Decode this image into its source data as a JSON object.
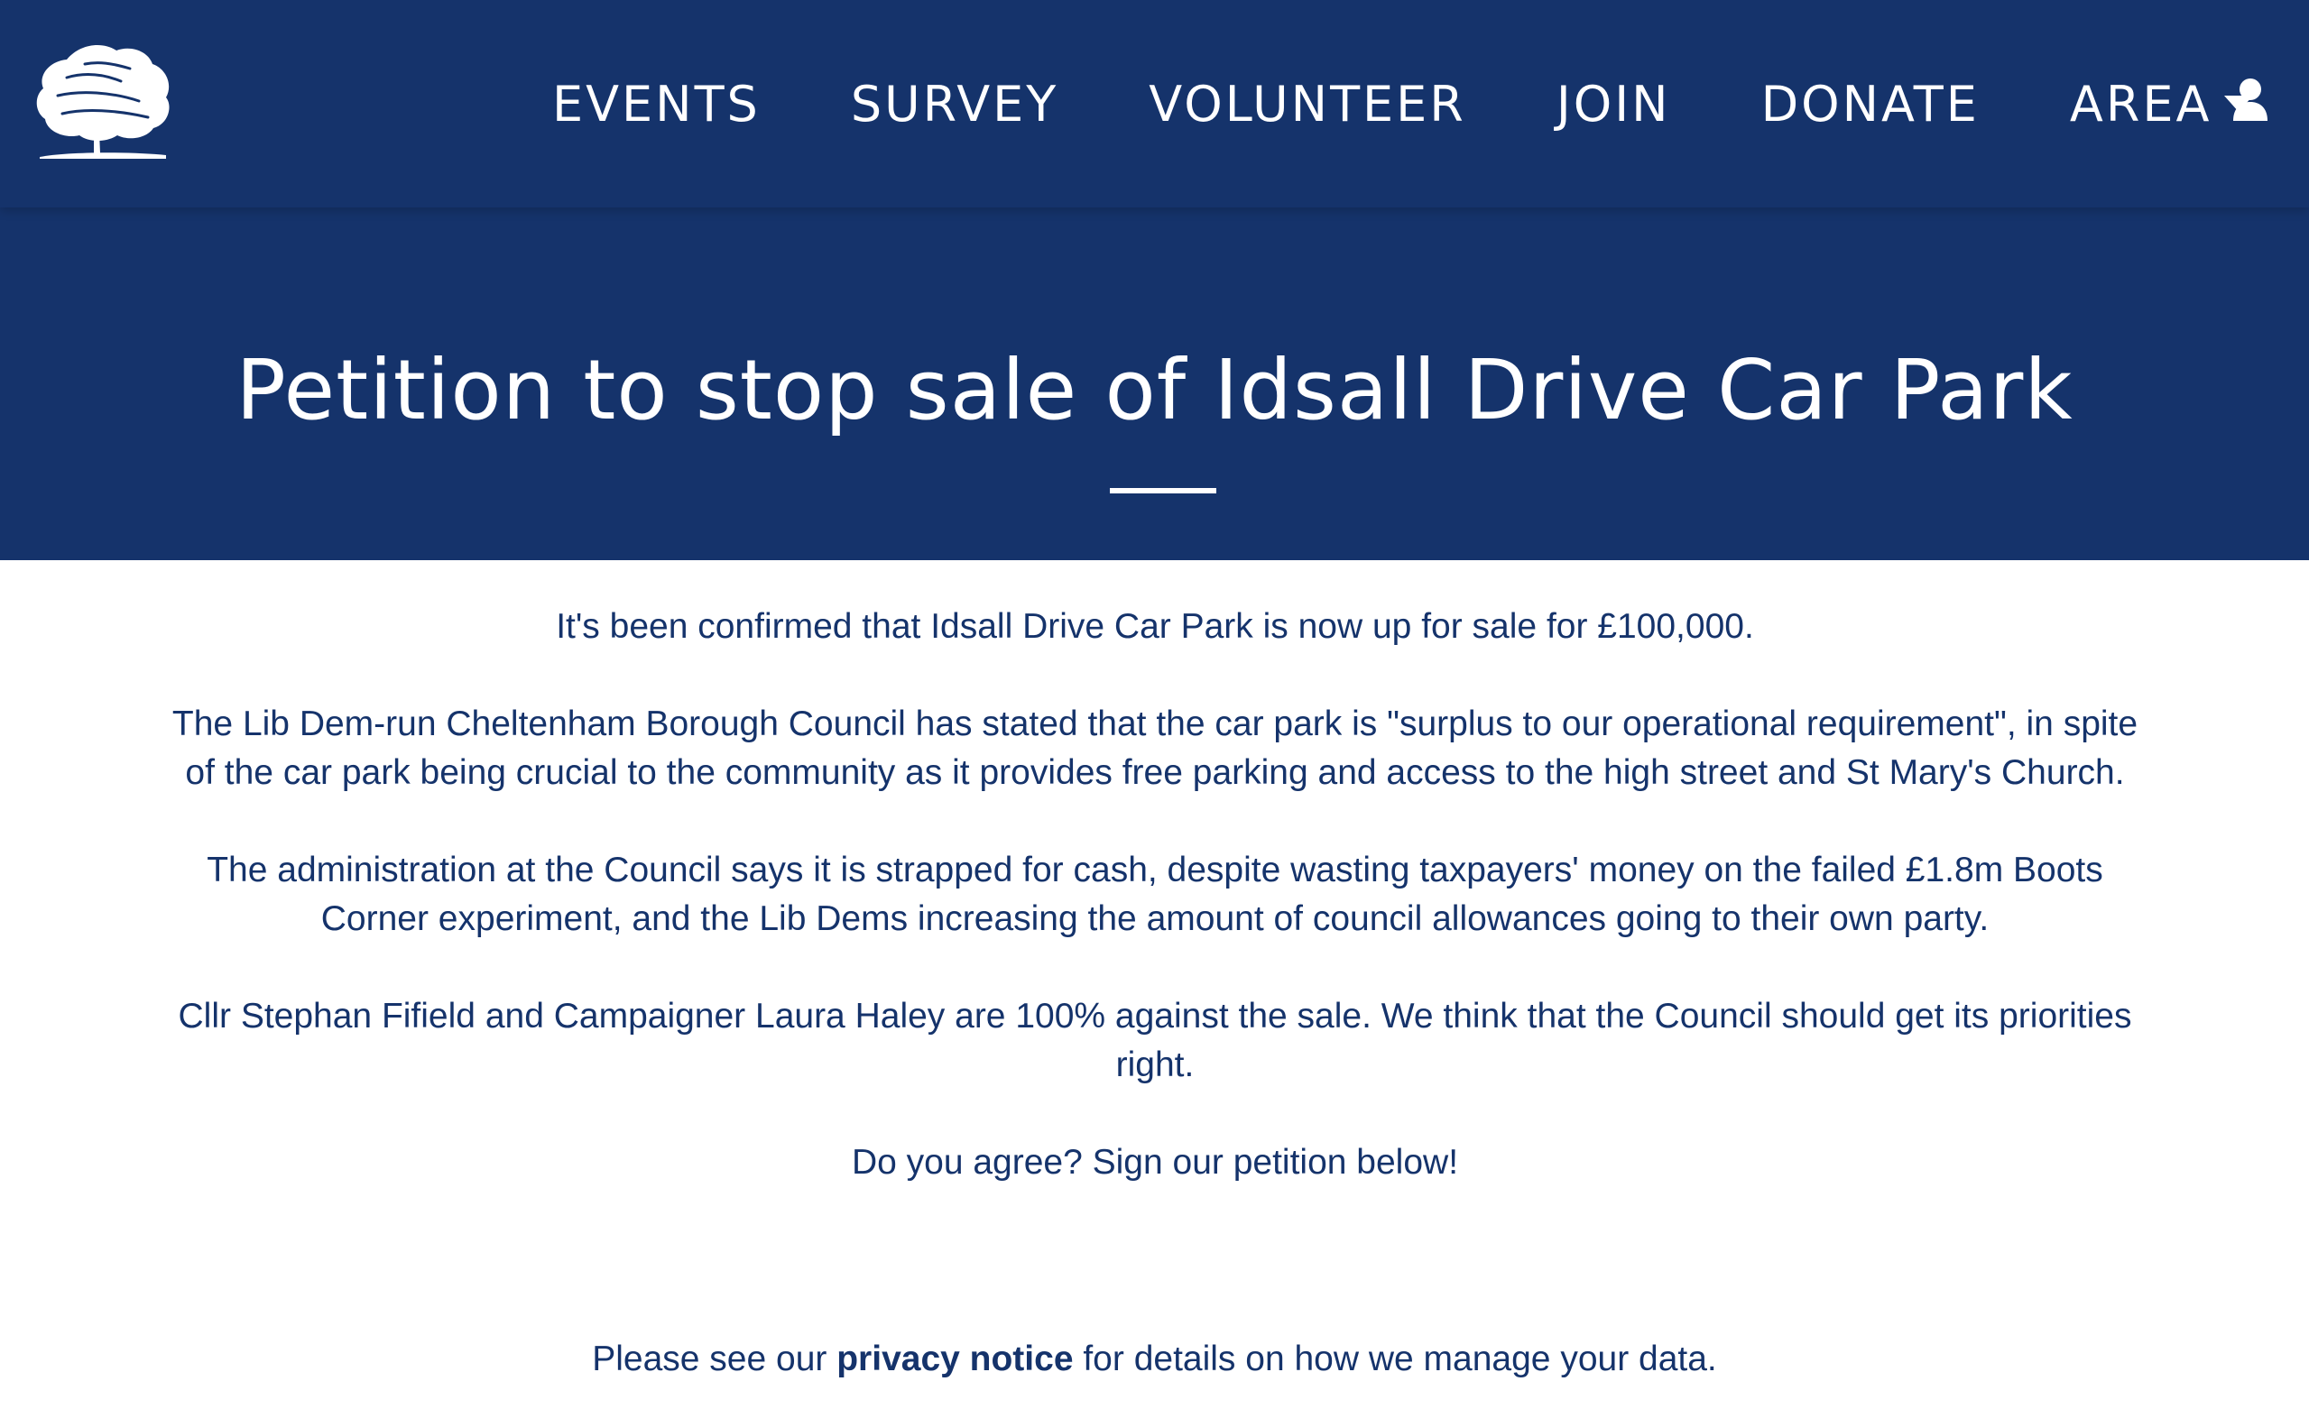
{
  "navbar": {
    "logo_name": "tree-logo",
    "items": [
      {
        "label": "EVENTS"
      },
      {
        "label": "SURVEY"
      },
      {
        "label": "VOLUNTEER"
      },
      {
        "label": "JOIN"
      },
      {
        "label": "DONATE"
      },
      {
        "label": "AREA"
      }
    ],
    "user_icon": "user-icon"
  },
  "hero": {
    "title": "Petition to stop sale of Idsall Drive Car Park"
  },
  "content": {
    "paragraphs": [
      "It's been confirmed that Idsall Drive Car Park is now up for sale for £100,000.",
      "The Lib Dem-run Cheltenham Borough Council has stated that the car park is \"surplus to our operational requirement\", in spite of the car park being crucial to the community as it provides free parking and access to the high street and St Mary's Church.",
      "The administration at the Council says it is strapped for cash, despite wasting taxpayers' money on the failed £1.8m Boots Corner experiment, and the Lib Dems increasing the amount of council allowances going to their own party.",
      "Cllr Stephan Fifield and Campaigner Laura Haley are 100% against the sale. We think that the Council should get its priorities right.",
      "Do you agree? Sign our petition below!"
    ],
    "privacy_prefix": "Please see our ",
    "privacy_link": "privacy notice",
    "privacy_suffix": " for details on how we manage your data."
  },
  "colors": {
    "brand_navy": "#15336b",
    "white": "#ffffff"
  }
}
